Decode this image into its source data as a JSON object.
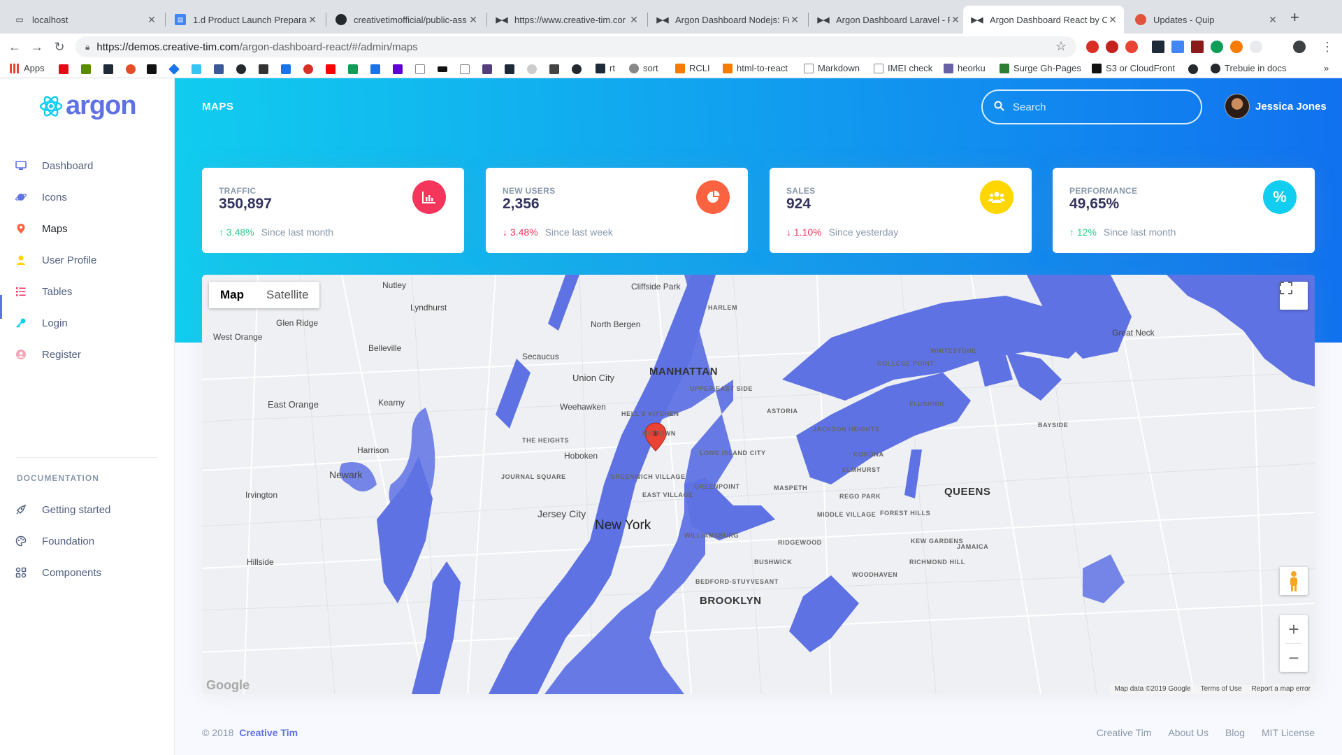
{
  "browser": {
    "tabs": [
      {
        "title": "localhost",
        "icon": "page-icon"
      },
      {
        "title": "1.d Product Launch Preparati",
        "icon": "docs-icon"
      },
      {
        "title": "creativetimofficial/public-ass",
        "icon": "github-icon"
      },
      {
        "title": "https://www.creative-tim.cor",
        "icon": "ct-icon"
      },
      {
        "title": "Argon Dashboard Nodejs: Fr",
        "icon": "ct-icon"
      },
      {
        "title": "Argon Dashboard Laravel - F",
        "icon": "ct-icon"
      },
      {
        "title": "Argon Dashboard React by C",
        "icon": "ct-icon",
        "active": true
      },
      {
        "title": "Updates - Quip",
        "icon": "quip-icon"
      }
    ],
    "url_host": "https://demos.creative-tim.com",
    "url_path": "/argon-dashboard-react/#/admin/maps",
    "bookmarks": {
      "apps": "Apps",
      "rt": "rt",
      "sort": "sort",
      "rcli": "RCLI",
      "html_to_react": "html-to-react",
      "markdown": "Markdown",
      "imei": "IMEI check",
      "heorku": "heorku",
      "surge": "Surge Gh-Pages",
      "s3": "S3 or CloudFront",
      "trebuie": "Trebuie in docs"
    }
  },
  "sidebar": {
    "brand": "argon",
    "items": [
      {
        "label": "Dashboard",
        "icon": "tv-icon",
        "color": "#5e72e4"
      },
      {
        "label": "Icons",
        "icon": "planet-icon",
        "color": "#5e72e4"
      },
      {
        "label": "Maps",
        "icon": "pin-icon",
        "color": "#fb6340",
        "active": true
      },
      {
        "label": "User Profile",
        "icon": "user-icon",
        "color": "#ffd600"
      },
      {
        "label": "Tables",
        "icon": "bullet-list-icon",
        "color": "#f5365c"
      },
      {
        "label": "Login",
        "icon": "key-icon",
        "color": "#11cdef"
      },
      {
        "label": "Register",
        "icon": "circle-user-icon",
        "color": "#f3a4b5"
      }
    ],
    "doc_heading": "DOCUMENTATION",
    "doc_items": [
      {
        "label": "Getting started",
        "icon": "spaceship-icon"
      },
      {
        "label": "Foundation",
        "icon": "palette-icon"
      },
      {
        "label": "Components",
        "icon": "ui-icon"
      }
    ]
  },
  "header": {
    "title": "MAPS",
    "search_placeholder": "Search",
    "user_name": "Jessica Jones"
  },
  "cards": [
    {
      "title": "TRAFFIC",
      "value": "350,897",
      "change": "3.48%",
      "direction": "up",
      "since": "Since last month",
      "icon": "chart-bar-icon",
      "color": "#f5365c"
    },
    {
      "title": "NEW USERS",
      "value": "2,356",
      "change": "3.48%",
      "direction": "down",
      "since": "Since last week",
      "icon": "chart-pie-icon",
      "color": "#fb6340"
    },
    {
      "title": "SALES",
      "value": "924",
      "change": "1.10%",
      "direction": "down",
      "since": "Since yesterday",
      "icon": "users-icon",
      "color": "#ffd600"
    },
    {
      "title": "PERFORMANCE",
      "value": "49,65%",
      "change": "12%",
      "direction": "up",
      "since": "Since last month",
      "icon": "percent-icon",
      "color": "#11cdef"
    }
  ],
  "map": {
    "type_map": "Map",
    "type_satellite": "Satellite",
    "water_color": "#5e72e4",
    "labels": {
      "manhattan": "MANHATTAN",
      "new_york": "New York",
      "jersey_city": "Jersey City",
      "brooklyn": "BROOKLYN",
      "queens": "QUEENS",
      "newark": "Newark",
      "hoboken": "Hoboken",
      "union_city": "Union City",
      "east_orange": "East Orange",
      "harlem": "HARLEM",
      "astoria": "ASTORIA",
      "flushing": "FLUSHING",
      "williamsburg": "WILLIAMSBURG",
      "west_orange": "West Orange",
      "belleville": "Belleville",
      "nutley": "Nutley",
      "lyndhurst": "Lyndhurst",
      "kearny": "Kearny",
      "harrison": "Harrison",
      "irvington": "Irvington",
      "hillside": "Hillside",
      "secaucus": "Secaucus",
      "weehawken": "Weehawken",
      "north_bergen": "North Bergen",
      "cliffside_park": "Cliffside Park",
      "glen_ridge": "Glen Ridge",
      "great_neck": "Great Neck",
      "greenpoint": "GREENPOINT",
      "corona": "CORONA",
      "elmhurst": "ELMHURST",
      "jackson_heights": "JACKSON HEIGHTS",
      "east_village": "EAST VILLAGE",
      "greenwich_village": "GREENWICH VILLAGE",
      "hells_kitchen": "HELL'S KITCHEN",
      "midtown": "MIDTOWN",
      "upper_east_side": "UPPER EAST SIDE",
      "long_island_city": "LONG ISLAND CITY",
      "bushwick": "BUSHWICK",
      "ridgewood": "RIDGEWOOD",
      "jamaica": "JAMAICA",
      "bayside": "BAYSIDE",
      "college_point": "COLLEGE POINT",
      "whitestone": "WHITESTONE",
      "the_heights": "THE HEIGHTS",
      "journal_square": "JOURNAL SQUARE",
      "bed_stuy": "BEDFORD-STUYVESANT",
      "woodhaven": "WOODHAVEN",
      "richmond_hill": "RICHMOND HILL",
      "kew_gardens": "KEW GARDENS",
      "forest_hills": "FOREST HILLS",
      "middle_village": "MIDDLE VILLAGE",
      "maspeth": "MASPETH",
      "rego_park": "REGO PARK"
    },
    "google": "Google",
    "attribution": [
      "Map data ©2019 Google",
      "Terms of Use",
      "Report a map error"
    ]
  },
  "footer": {
    "copyright": "© 2018",
    "brand": "Creative Tim",
    "links": [
      "Creative Tim",
      "About Us",
      "Blog",
      "MIT License"
    ]
  }
}
